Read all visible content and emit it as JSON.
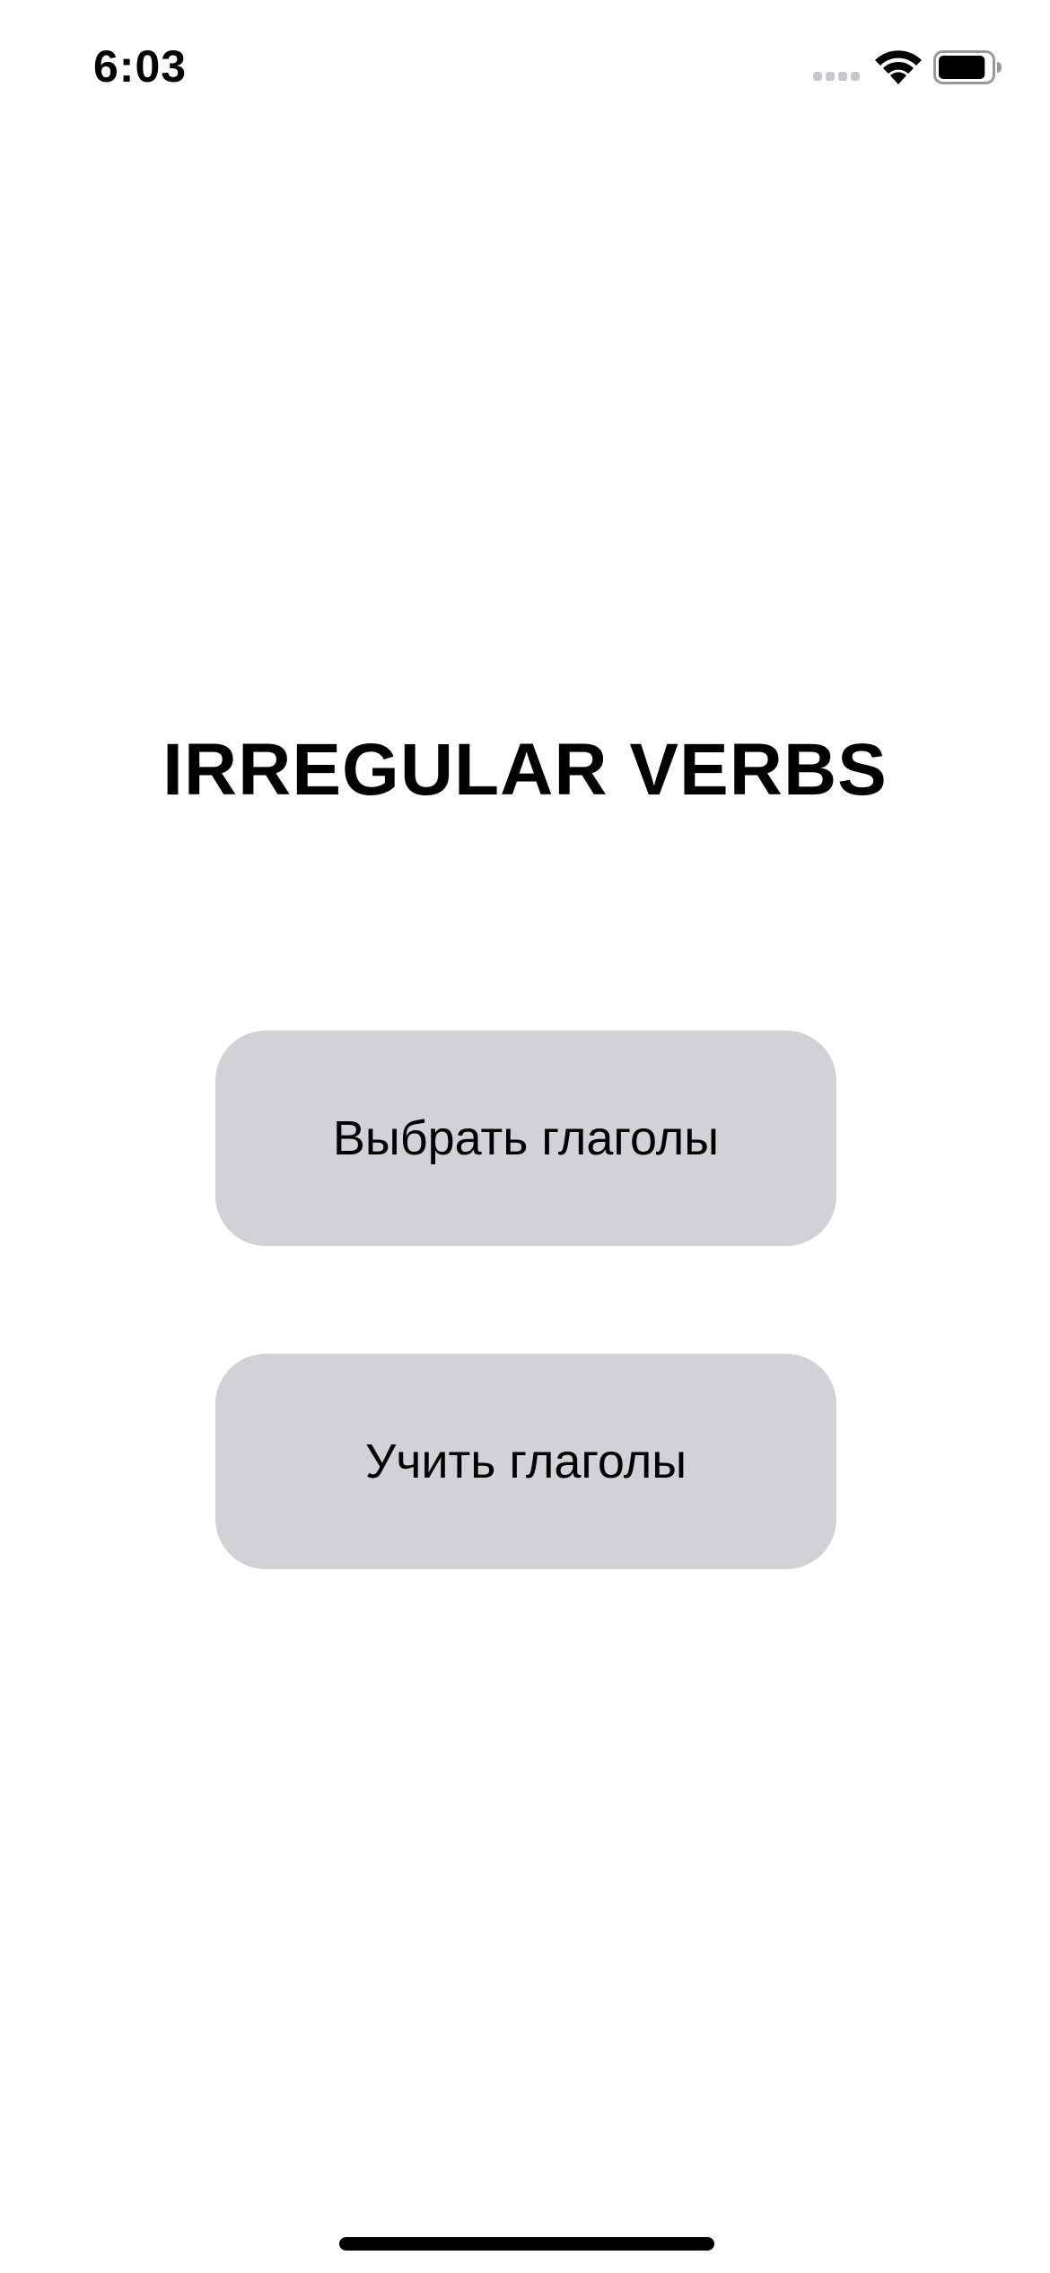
{
  "status_bar": {
    "time": "6:03",
    "signal_icon": "cellular-signal-icon",
    "wifi_icon": "wifi-icon",
    "battery_icon": "battery-icon",
    "battery_level": 0.9
  },
  "main": {
    "title": "IRREGULAR VERBS",
    "buttons": [
      {
        "label": "Выбрать глаголы"
      },
      {
        "label": "Учить глаголы"
      }
    ]
  },
  "colors": {
    "background": "#ffffff",
    "button_fill": "#d1d1d6",
    "text": "#000000",
    "inactive_signal": "#c7c7cc"
  }
}
